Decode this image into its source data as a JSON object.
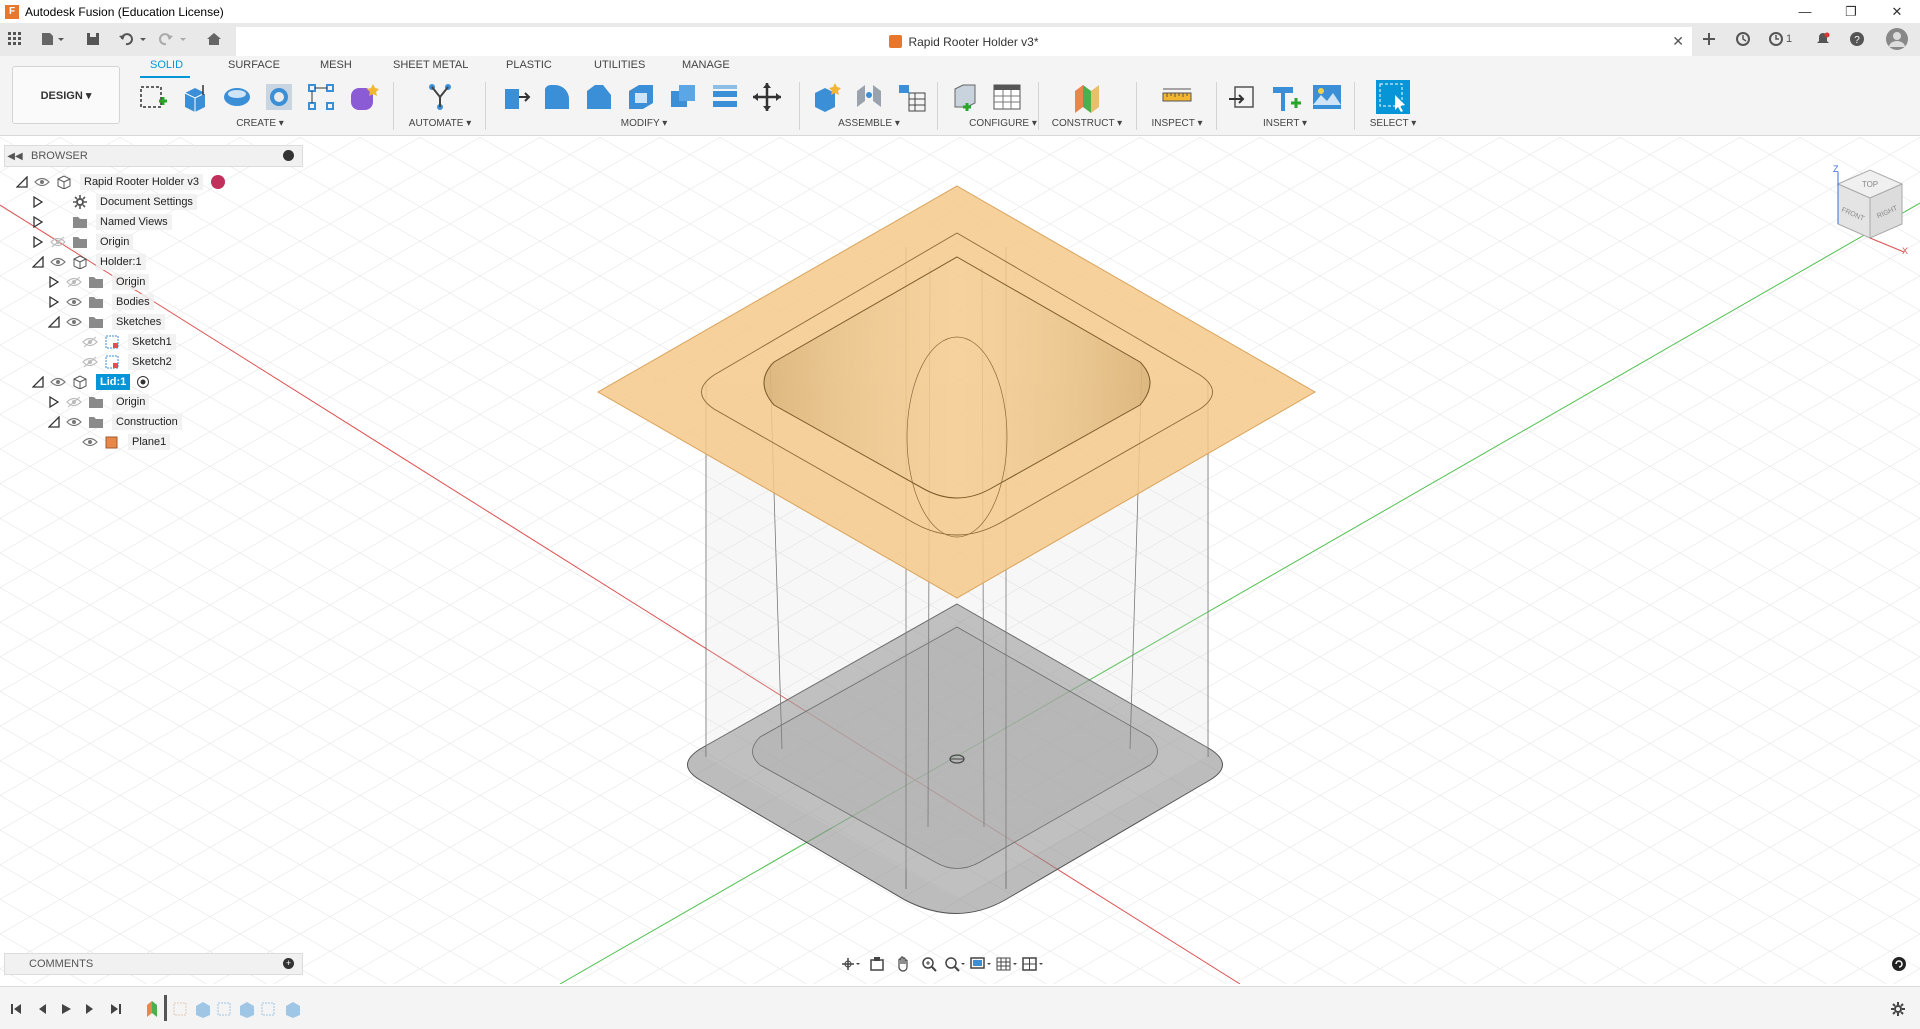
{
  "app": {
    "title": "Autodesk Fusion (Education License)",
    "window_controls": [
      "minimize-icon",
      "restore-icon",
      "close-icon"
    ]
  },
  "document": {
    "title": "Rapid Rooter Holder v3*",
    "notifications_count": "1"
  },
  "workspace": {
    "label": "DESIGN ▾"
  },
  "ribbon": {
    "tabs": [
      "SOLID",
      "SURFACE",
      "MESH",
      "SHEET METAL",
      "PLASTIC",
      "UTILITIES",
      "MANAGE"
    ],
    "active_tab": "SOLID",
    "groups": [
      "CREATE ▾",
      "AUTOMATE ▾",
      "MODIFY ▾",
      "ASSEMBLE ▾",
      "CONFIGURE ▾",
      "CONSTRUCT ▾",
      "INSPECT ▾",
      "INSERT ▾",
      "SELECT ▾"
    ]
  },
  "browser": {
    "title": "BROWSER",
    "nodes": [
      {
        "label": "Rapid Rooter Holder v3",
        "expanded": true,
        "icon": "component-icon"
      },
      {
        "label": "Document Settings",
        "expanded": false,
        "icon": "gear-icon"
      },
      {
        "label": "Named Views",
        "expanded": false,
        "icon": "folder-icon"
      },
      {
        "label": "Origin",
        "expanded": false,
        "icon": "folder-icon"
      },
      {
        "label": "Holder:1",
        "expanded": true,
        "icon": "component-icon"
      },
      {
        "label": "Origin",
        "expanded": false,
        "icon": "folder-icon"
      },
      {
        "label": "Bodies",
        "expanded": false,
        "icon": "folder-icon"
      },
      {
        "label": "Sketches",
        "expanded": true,
        "icon": "folder-icon"
      },
      {
        "label": "Sketch1",
        "icon": "sketch-icon"
      },
      {
        "label": "Sketch2",
        "icon": "sketch-icon"
      },
      {
        "label": "Lid:1",
        "expanded": true,
        "icon": "component-icon",
        "selected": true
      },
      {
        "label": "Origin",
        "expanded": false,
        "icon": "folder-icon"
      },
      {
        "label": "Construction",
        "expanded": true,
        "icon": "folder-icon"
      },
      {
        "label": "Plane1",
        "icon": "plane-icon"
      }
    ]
  },
  "comments": {
    "title": "COMMENTS"
  },
  "viewcube": {
    "faces": [
      "TOP",
      "FRONT",
      "RIGHT"
    ],
    "axes": [
      "Z",
      "X"
    ]
  },
  "colors": {
    "accent": "#0696d7",
    "plane": "#f5c98a",
    "body": "#b8b8b8",
    "x_axis": "#e05050",
    "y_axis": "#4ec04e"
  }
}
